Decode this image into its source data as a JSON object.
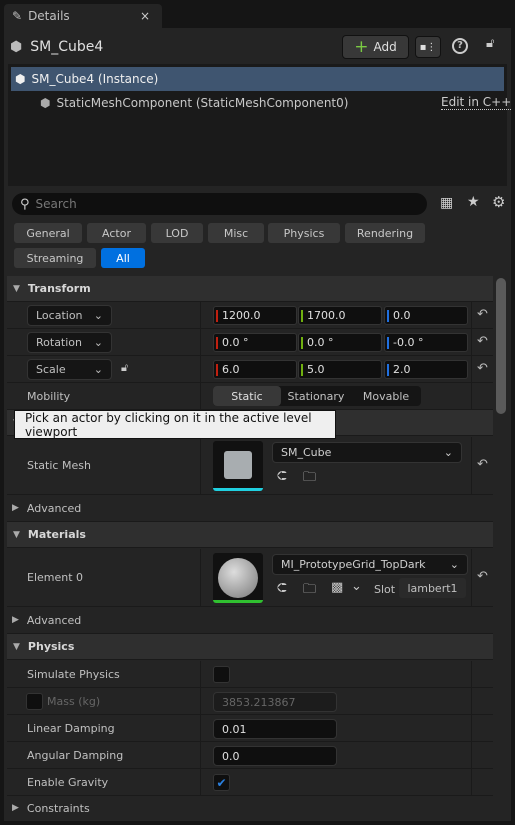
{
  "tab": {
    "title": "Details",
    "icon": "pencil-icon",
    "close": "×"
  },
  "header": {
    "title": "SM_Cube4",
    "add_label": "Add",
    "add_icon": "+"
  },
  "tree": {
    "instance": "SM_Cube4 (Instance)",
    "component": "StaticMeshComponent (StaticMeshComponent0)",
    "edit_link": "Edit in C++"
  },
  "search": {
    "placeholder": "Search"
  },
  "filters": [
    "General",
    "Actor",
    "LOD",
    "Misc",
    "Physics",
    "Rendering",
    "Streaming",
    "All"
  ],
  "active_filter": "All",
  "transform": {
    "title": "Transform",
    "location": {
      "label": "Location",
      "x": "1200.0",
      "y": "1700.0",
      "z": "0.0"
    },
    "rotation": {
      "label": "Rotation",
      "x": "0.0 °",
      "y": "0.0 °",
      "z": "-0.0 °"
    },
    "scale": {
      "label": "Scale",
      "x": "6.0",
      "y": "5.0",
      "z": "2.0"
    },
    "mobility": {
      "label": "Mobility",
      "options": [
        "Static",
        "Stationary",
        "Movable"
      ],
      "selected": "Static"
    }
  },
  "tooltip": "Pick an actor by clicking on it in the active level viewport",
  "static_mesh": {
    "label": "Static Mesh",
    "value": "SM_Cube",
    "advanced": "Advanced"
  },
  "materials": {
    "title": "Materials",
    "element_label": "Element 0",
    "value": "MI_PrototypeGrid_TopDark",
    "slot_label": "Slot",
    "slot_value": "lambert1",
    "advanced": "Advanced"
  },
  "physics": {
    "title": "Physics",
    "simulate": "Simulate Physics",
    "simulate_checked": false,
    "mass_label": "Mass (kg)",
    "mass_value": "3853.213867",
    "linear_label": "Linear Damping",
    "linear_value": "0.01",
    "angular_label": "Angular Damping",
    "angular_value": "0.0",
    "gravity_label": "Enable Gravity",
    "gravity_checked": true,
    "constraints": "Constraints"
  },
  "colors": {
    "x_axis": "#c02010",
    "y_axis": "#70b010",
    "z_axis": "#2070e0",
    "selection": "#3f5570",
    "accent": "#0070e0",
    "mesh_underline": "#20d0e0",
    "material_underline": "#30c030"
  }
}
